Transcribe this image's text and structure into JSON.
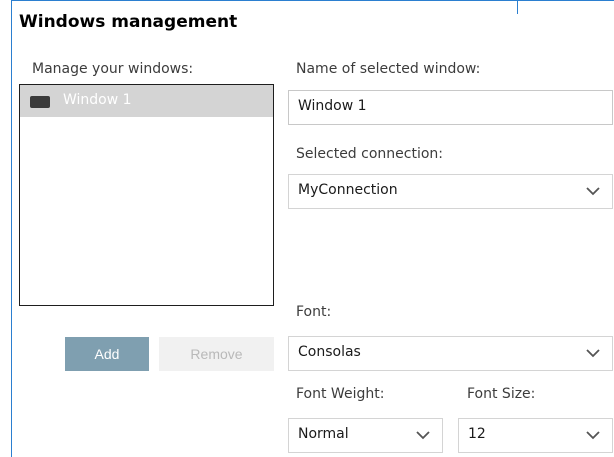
{
  "section": {
    "title": "Windows management"
  },
  "windows_list": {
    "label": "Manage your windows:",
    "items": [
      {
        "label": "Window 1",
        "icon": "window-icon",
        "selected": true
      }
    ]
  },
  "buttons": {
    "add_label": "Add",
    "remove_label": "Remove"
  },
  "window_name": {
    "label": "Name of selected window:",
    "value": "Window 1"
  },
  "connection": {
    "label": "Selected connection:",
    "value": "MyConnection"
  },
  "font": {
    "label": "Font:",
    "value": "Consolas"
  },
  "font_weight": {
    "label": "Font Weight:",
    "value": "Normal"
  },
  "font_size": {
    "label": "Font Size:",
    "value": "12"
  },
  "colors": {
    "frame_border": "#2b7fd0",
    "add_button": "#7f9fb0",
    "selection": "#d4d4d4"
  }
}
